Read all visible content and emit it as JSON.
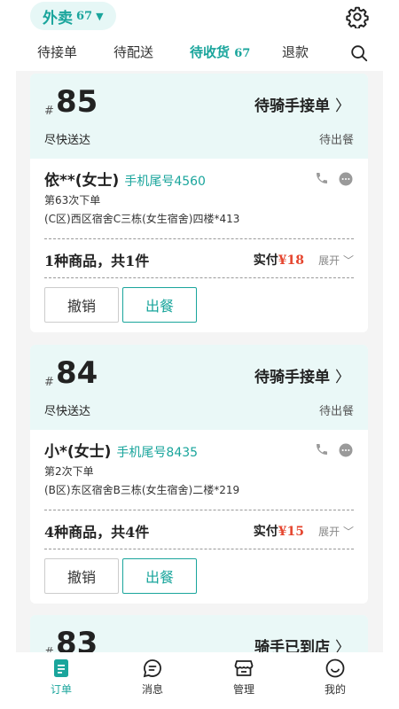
{
  "header": {
    "type_label": "外卖",
    "type_count": "67",
    "caret": "▼"
  },
  "tabs": [
    {
      "label": "待接单",
      "count": ""
    },
    {
      "label": "待配送",
      "count": ""
    },
    {
      "label": "待收货",
      "count": "67"
    },
    {
      "label": "退款",
      "count": ""
    }
  ],
  "orders": [
    {
      "hash": "#",
      "number": "85",
      "status": "待骑手接单",
      "chevron": "〉",
      "delivery": "尽快送达",
      "wait": "待出餐",
      "customer": "依**(女士)",
      "phone": "手机尾号4560",
      "nth": "第63次下单",
      "address": "(C区)西区宿舍C三栋(女生宿舍)四楼*413",
      "goods": "1种商品，共1件",
      "pay_label": "实付",
      "pay_amount": "¥18",
      "expand": "展开 ﹀",
      "cancel": "撤销",
      "ready": "出餐"
    },
    {
      "hash": "#",
      "number": "84",
      "status": "待骑手接单",
      "chevron": "〉",
      "delivery": "尽快送达",
      "wait": "待出餐",
      "customer": "小*(女士)",
      "phone": "手机尾号8435",
      "nth": "第2次下单",
      "address": "(B区)东区宿舍B三栋(女生宿舍)二楼*219",
      "goods": "4种商品，共4件",
      "pay_label": "实付",
      "pay_amount": "¥15",
      "expand": "展开 ﹀",
      "cancel": "撤销",
      "ready": "出餐"
    },
    {
      "hash": "#",
      "number": "83",
      "status": "骑手已到店",
      "chevron": "〉"
    }
  ],
  "nav": [
    {
      "label": "订单",
      "icon": "order-icon"
    },
    {
      "label": "消息",
      "icon": "message-icon"
    },
    {
      "label": "管理",
      "icon": "store-icon"
    },
    {
      "label": "我的",
      "icon": "profile-icon"
    }
  ],
  "colors": {
    "accent": "#1aa59c",
    "card_head": "#eaf8f7",
    "price": "#e5462f"
  }
}
